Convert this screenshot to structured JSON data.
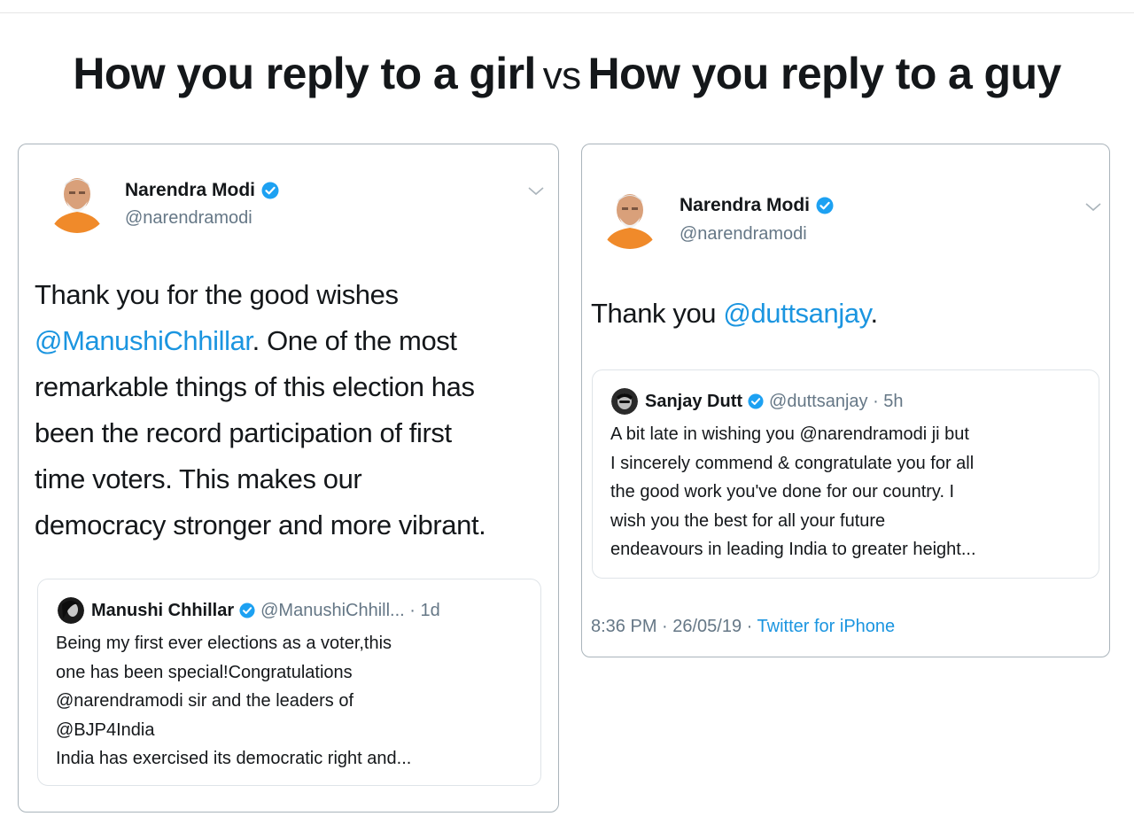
{
  "headline": {
    "left": "How you reply to a girl",
    "vs": "vs",
    "right": "How you reply to a guy"
  },
  "left_tweet": {
    "author_name": "Narendra Modi",
    "author_handle": "@narendramodi",
    "text_lines": [
      "Thank you for the good wishes",
      "@ManushiChhillar",
      ". One of the most",
      "remarkable things of this election has",
      "been the record participation of first",
      "time voters. This makes our",
      "democracy stronger and more vibrant."
    ],
    "quote": {
      "name": "Manushi Chhillar",
      "handle_time": "@ManushiChhill... · 1d",
      "lines": [
        "Being my first ever elections as a voter,this",
        "one has been special!Congratulations",
        "@narendramodi sir and the leaders of",
        "@BJP4India",
        "India has exercised its democratic right and..."
      ]
    }
  },
  "right_tweet": {
    "author_name": "Narendra Modi",
    "author_handle": "@narendramodi",
    "text_prefix": "Thank you ",
    "text_mention": "@duttsanjay",
    "text_suffix": ".",
    "quote": {
      "name": "Sanjay Dutt",
      "handle_time": "@duttsanjay · 5h",
      "lines": [
        "A bit late in wishing you @narendramodi ji but",
        "I sincerely commend & congratulate you for all",
        "the good work you've done for our country. I",
        "wish you the best for all your future",
        "endeavours in leading India to greater height..."
      ]
    },
    "meta_time": "8:36 PM · 26/05/19 · ",
    "meta_source": "Twitter for iPhone"
  },
  "colors": {
    "link": "#1b95e0",
    "secondary_text": "#657786",
    "verified": "#1da1f2",
    "card_border": "#aab4bb"
  },
  "icons": [
    "verified-badge-icon",
    "chevron-down-icon",
    "avatar-photo"
  ]
}
